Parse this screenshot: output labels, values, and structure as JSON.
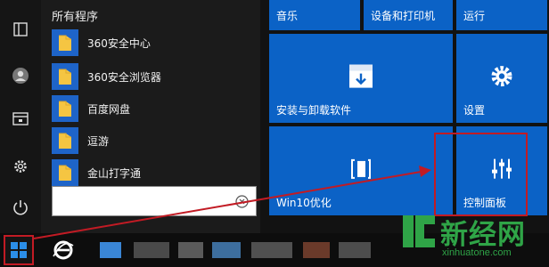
{
  "program_list": {
    "heading": "所有程序",
    "items": [
      {
        "label": "360安全中心",
        "icon": "folder-icon"
      },
      {
        "label": "360安全浏览器",
        "icon": "folder-icon"
      },
      {
        "label": "百度网盘",
        "icon": "folder-icon"
      },
      {
        "label": "逗游",
        "icon": "folder-icon"
      },
      {
        "label": "金山打字通",
        "icon": "folder-icon"
      }
    ]
  },
  "search": {
    "value": "",
    "placeholder": ""
  },
  "tiles": {
    "music": "音乐",
    "devices_printers": "设备和打印机",
    "run": "运行",
    "uninstall": "安装与卸载软件",
    "settings": "设置",
    "win10_optimize": "Win10优化",
    "control_panel": "控制面板"
  },
  "watermark": {
    "name": "新经网",
    "domain": "xinhuatone.com"
  },
  "colors": {
    "tile_blue": "#0b62c6",
    "highlight_red": "#c21b24",
    "watermark_green": "#2fa447"
  }
}
